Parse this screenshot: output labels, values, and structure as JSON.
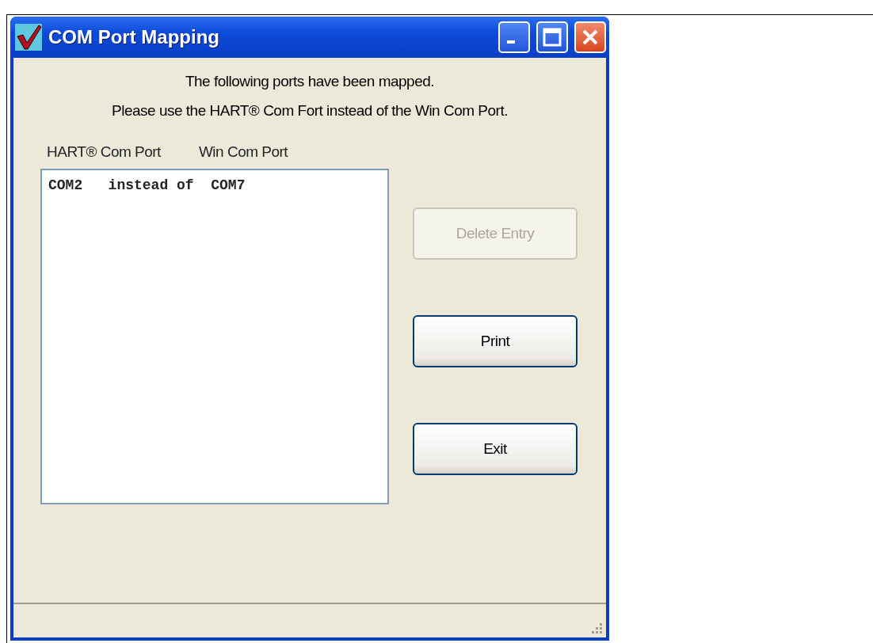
{
  "window": {
    "title": "COM Port Mapping"
  },
  "messages": [
    "The following ports have been mapped.",
    "Please use the HART® Com Fort instead of the Win Com Port."
  ],
  "list": {
    "columns": [
      "HART® Com Port",
      "Win Com Port"
    ],
    "rows": [
      {
        "text": "COM2   instead of  COM7",
        "selected": false
      }
    ]
  },
  "buttons": [
    {
      "label": "Delete Entry",
      "disabled": true
    },
    {
      "label": "Print",
      "disabled": false
    },
    {
      "label": "Exit",
      "disabled": false
    }
  ]
}
